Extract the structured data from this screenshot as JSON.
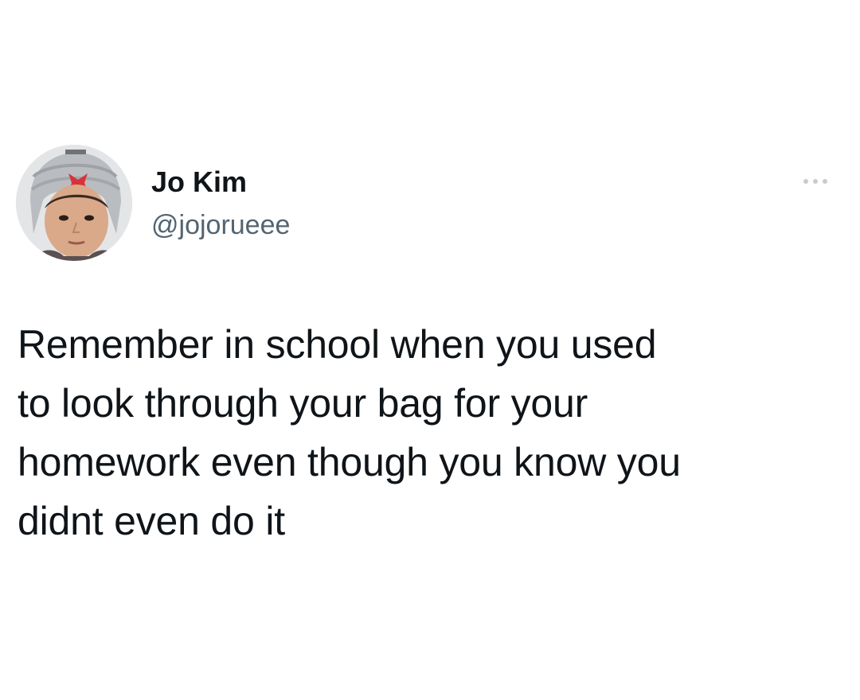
{
  "tweet": {
    "author": {
      "name": "Jo Kim",
      "handle": "@jojorueee",
      "avatar_icon": "user-avatar-photo"
    },
    "more_icon": "more-options-icon",
    "text": "Remember in school when you used\nto look through your bag for your\nhomework even though you know you\ndidnt even do it"
  },
  "colors": {
    "background": "#ffffff",
    "name": "#0f1419",
    "handle": "#536471",
    "text": "#0f1419"
  }
}
